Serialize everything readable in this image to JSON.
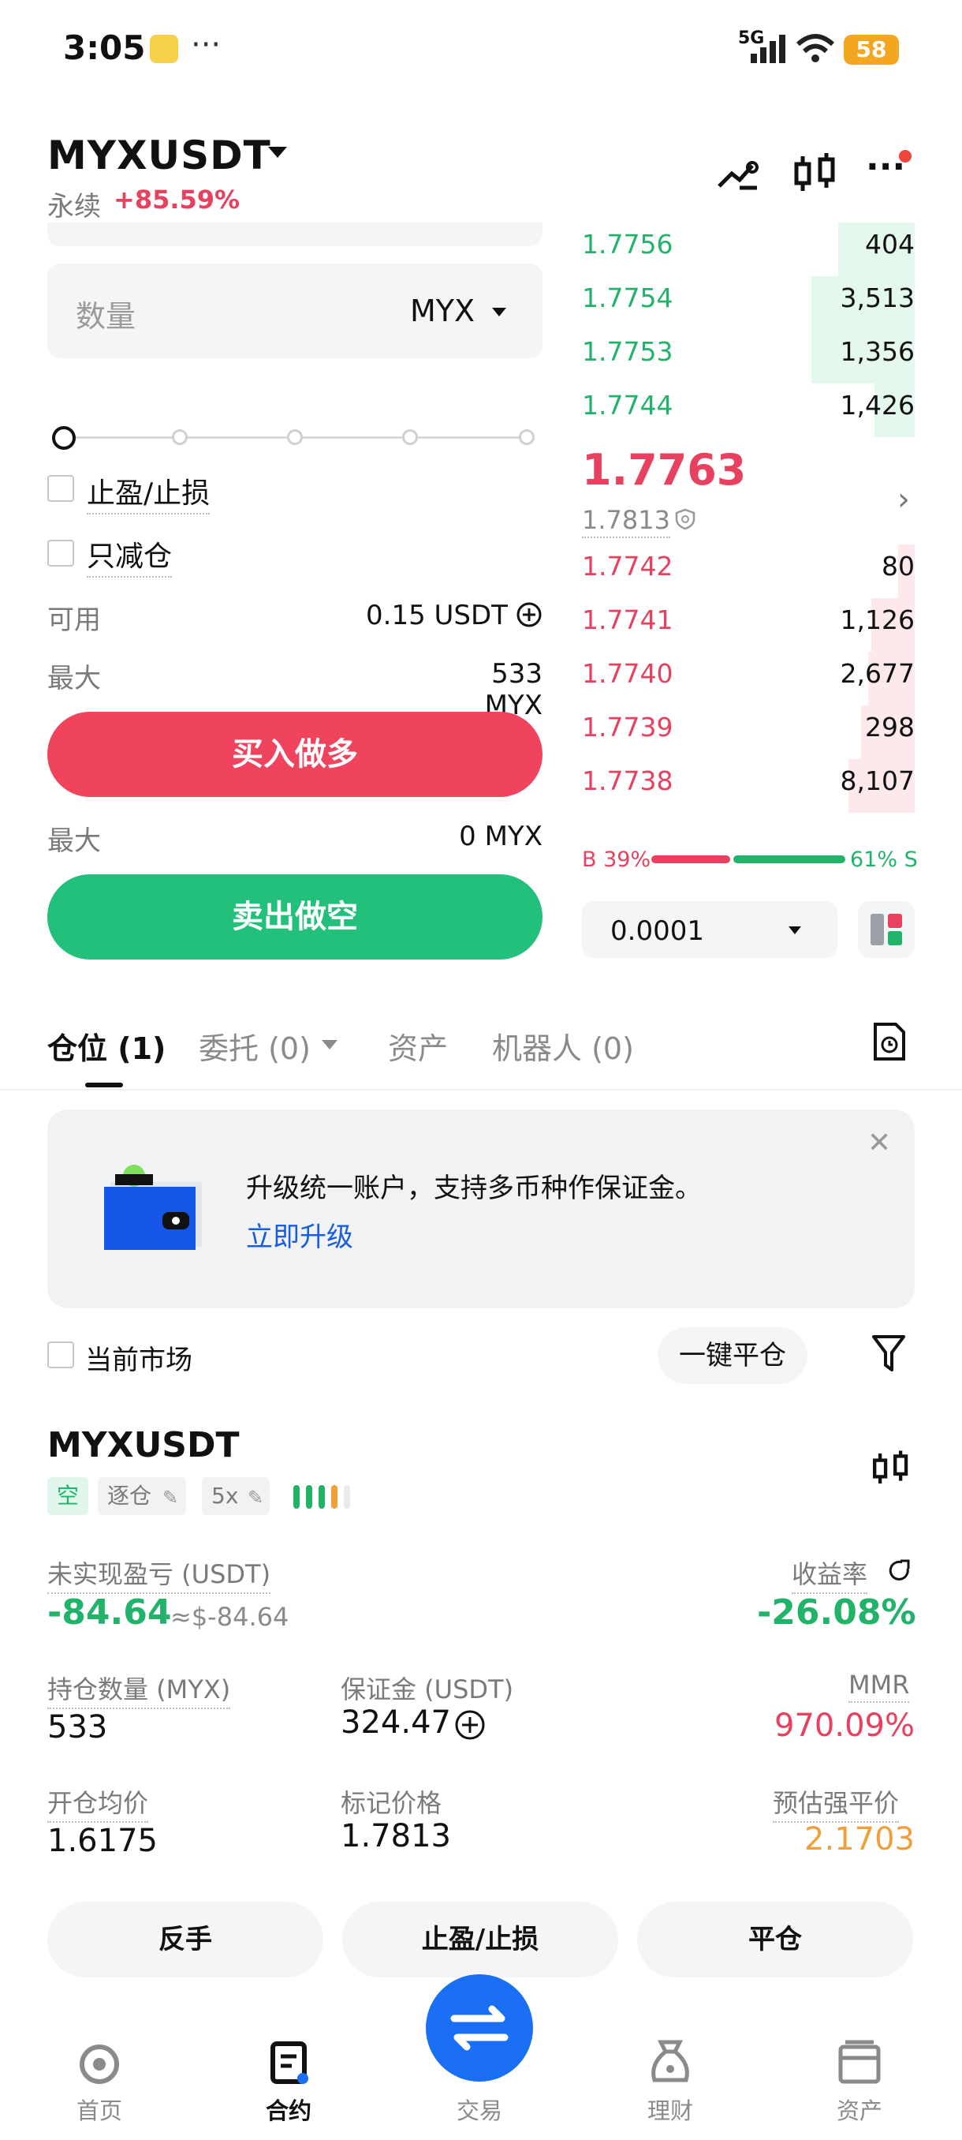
{
  "status_bar": {
    "time": "3:05",
    "network": "5G",
    "battery": "58",
    "dots": "···"
  },
  "header": {
    "pair": "MYXUSDT",
    "contract_type": "永续",
    "change": "+85.59%",
    "more": "···"
  },
  "order_form": {
    "qty_placeholder": "数量",
    "qty_unit": "MYX",
    "tpsl_label": "止盈/止损",
    "reduce_only_label": "只减仓",
    "available_label": "可用",
    "available_value": "0.15 USDT",
    "max_label": "最大",
    "max_buy_value": "533 MYX",
    "buy_button": "买入做多",
    "max_sell_value": "0 MYX",
    "sell_button": "卖出做空",
    "slider_percent": 0
  },
  "order_book": {
    "asks": [
      {
        "price": "1.7756",
        "qty": "404",
        "depth": 0.23
      },
      {
        "price": "1.7754",
        "qty": "3,513",
        "depth": 0.31
      },
      {
        "price": "1.7753",
        "qty": "1,356",
        "depth": 0.31
      },
      {
        "price": "1.7744",
        "qty": "1,426",
        "depth": 0.12
      }
    ],
    "last_price": "1.7763",
    "mark_price": "1.7813",
    "bids": [
      {
        "price": "1.7742",
        "qty": "80",
        "depth": 0.05
      },
      {
        "price": "1.7741",
        "qty": "1,126",
        "depth": 0.13
      },
      {
        "price": "1.7740",
        "qty": "2,677",
        "depth": 0.14
      },
      {
        "price": "1.7739",
        "qty": "298",
        "depth": 0.16
      },
      {
        "price": "1.7738",
        "qty": "8,107",
        "depth": 0.2
      }
    ],
    "buy_ratio": "B 39%",
    "sell_ratio": "61% S",
    "tick_size": "0.0001"
  },
  "tabs": [
    {
      "label": "仓位 (1)"
    },
    {
      "label": "委托 (0)"
    },
    {
      "label": "资产"
    },
    {
      "label": "机器人 (0)"
    }
  ],
  "banner": {
    "text": "升级统一账户，支持多币种作保证金。",
    "link": "立即升级"
  },
  "filter": {
    "current_market": "当前市场",
    "close_all": "一键平仓"
  },
  "position": {
    "symbol": "MYXUSDT",
    "side_tag": "空",
    "margin_mode_tag": "逐仓",
    "leverage_tag": "5x",
    "upnl_label": "未实现盈亏 (USDT)",
    "upnl_value": "-84.64",
    "upnl_usd": "≈$-84.64",
    "roe_label": "收益率",
    "roe_value": "-26.08%",
    "size_label": "持仓数量 (MYX)",
    "size_value": "533",
    "margin_label": "保证金 (USDT)",
    "margin_value": "324.47",
    "mmr_label": "MMR",
    "mmr_value": "970.09%",
    "entry_label": "开仓均价",
    "entry_value": "1.6175",
    "mark_label": "标记价格",
    "mark_value": "1.7813",
    "liq_label": "预估强平价",
    "liq_value": "2.1703",
    "actions": [
      "反手",
      "止盈/止损",
      "平仓"
    ]
  },
  "nav": [
    {
      "label": "首页"
    },
    {
      "label": "合约"
    },
    {
      "label": "交易"
    },
    {
      "label": "理财"
    },
    {
      "label": "资产"
    }
  ],
  "colors": {
    "buy": "#22b36b",
    "sell": "#e8405f",
    "accent": "#1a6ff5",
    "liq": "#f0a03b"
  }
}
